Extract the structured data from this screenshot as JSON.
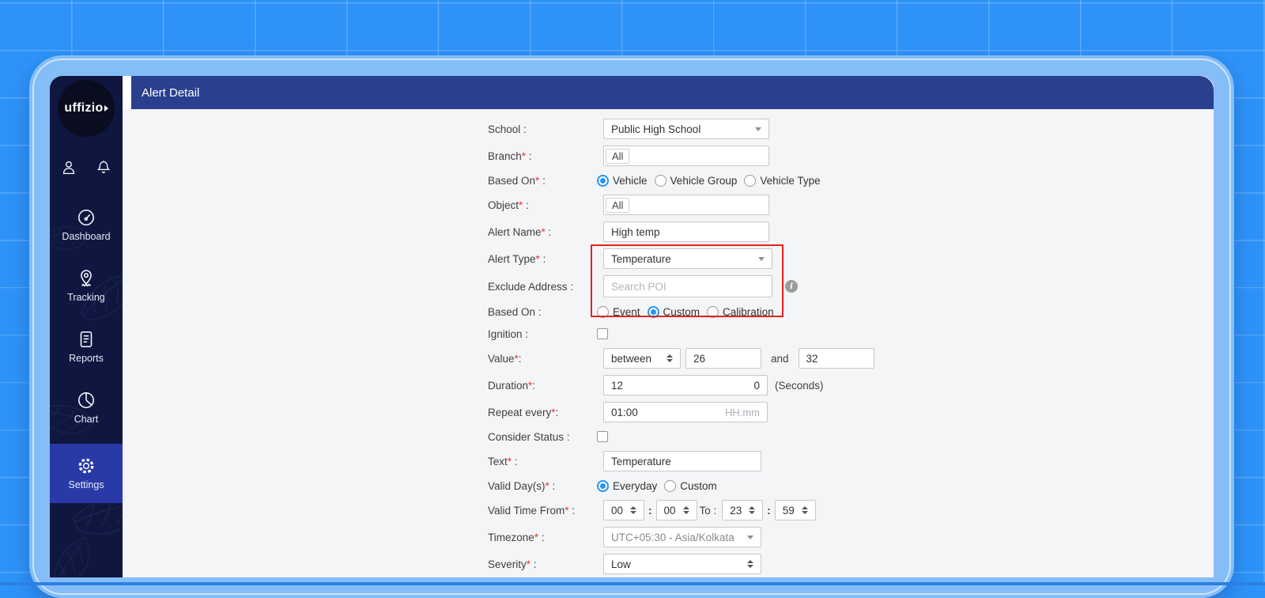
{
  "logo": {
    "text": "uffizio"
  },
  "sidebar": {
    "nav": [
      {
        "label": "Dashboard",
        "icon": "speedometer-icon",
        "active": false
      },
      {
        "label": "Tracking",
        "icon": "map-pin-icon",
        "active": false
      },
      {
        "label": "Reports",
        "icon": "report-icon",
        "active": false
      },
      {
        "label": "Chart",
        "icon": "pie-chart-icon",
        "active": false
      },
      {
        "label": "Settings",
        "icon": "gear-icon",
        "active": true
      }
    ]
  },
  "header": {
    "title": "Alert Detail"
  },
  "icons": {
    "info": "i"
  },
  "colors": {
    "background": "#2e93f8",
    "frame_border": "#85bdf8",
    "sidebar": "#0f1740",
    "header_bar": "#2a3f8e",
    "active_nav": "#2939a8",
    "accent_blue": "#2595f4",
    "highlight_red": "#e2231c",
    "form_background": "#f4f5f7"
  },
  "form": {
    "required_marker": "*",
    "school": {
      "label": "School",
      "colon": " :",
      "value": "Public High School"
    },
    "branch": {
      "label": "Branch",
      "colon": " :",
      "value": "All"
    },
    "based_on_vehicle": {
      "label": "Based On",
      "colon": " :",
      "options": [
        "Vehicle",
        "Vehicle Group",
        "Vehicle Type"
      ],
      "selected": "Vehicle"
    },
    "object": {
      "label": "Object",
      "colon": " :",
      "value": "All"
    },
    "alert_name": {
      "label": "Alert Name",
      "colon": " :",
      "value": "High temp"
    },
    "alert_type": {
      "label": "Alert Type",
      "colon": " :",
      "value": "Temperature"
    },
    "exclude_address": {
      "label": "Exclude Address",
      "colon": " :",
      "placeholder": "Search POI"
    },
    "based_on_mode": {
      "label": "Based On",
      "colon": " :",
      "options": [
        "Event",
        "Custom",
        "Calibration"
      ],
      "selected": "Custom"
    },
    "ignition": {
      "label": "Ignition",
      "colon": " :",
      "checked": false
    },
    "value": {
      "label": "Value",
      "colon": ":",
      "operator": "between",
      "from": "26",
      "conjunction": "and",
      "to": "32"
    },
    "duration": {
      "label": "Duration",
      "colon": ":",
      "value": "12",
      "value_right": "0",
      "unit": "(Seconds)"
    },
    "repeat_every": {
      "label": "Repeat every",
      "colon": ":",
      "value": "01:00",
      "hint": "HH:mm"
    },
    "consider_status": {
      "label": "Consider Status",
      "colon": " :",
      "checked": false
    },
    "text": {
      "label": "Text",
      "colon": " :",
      "value": "Temperature"
    },
    "valid_days": {
      "label": "Valid Day(s)",
      "colon": " :",
      "options": [
        "Everyday",
        "Custom"
      ],
      "selected": "Everyday"
    },
    "valid_time": {
      "label": "Valid Time From",
      "colon": " :",
      "from_hh": "00",
      "from_mm": "00",
      "separator": ":",
      "to_label": "To :",
      "to_hh": "23",
      "to_mm": "59"
    },
    "timezone": {
      "label": "Timezone",
      "colon": " :",
      "value": "UTC+05:30 - Asia/Kolkata"
    },
    "severity": {
      "label": "Severity",
      "colon": " :",
      "value": "Low"
    }
  }
}
